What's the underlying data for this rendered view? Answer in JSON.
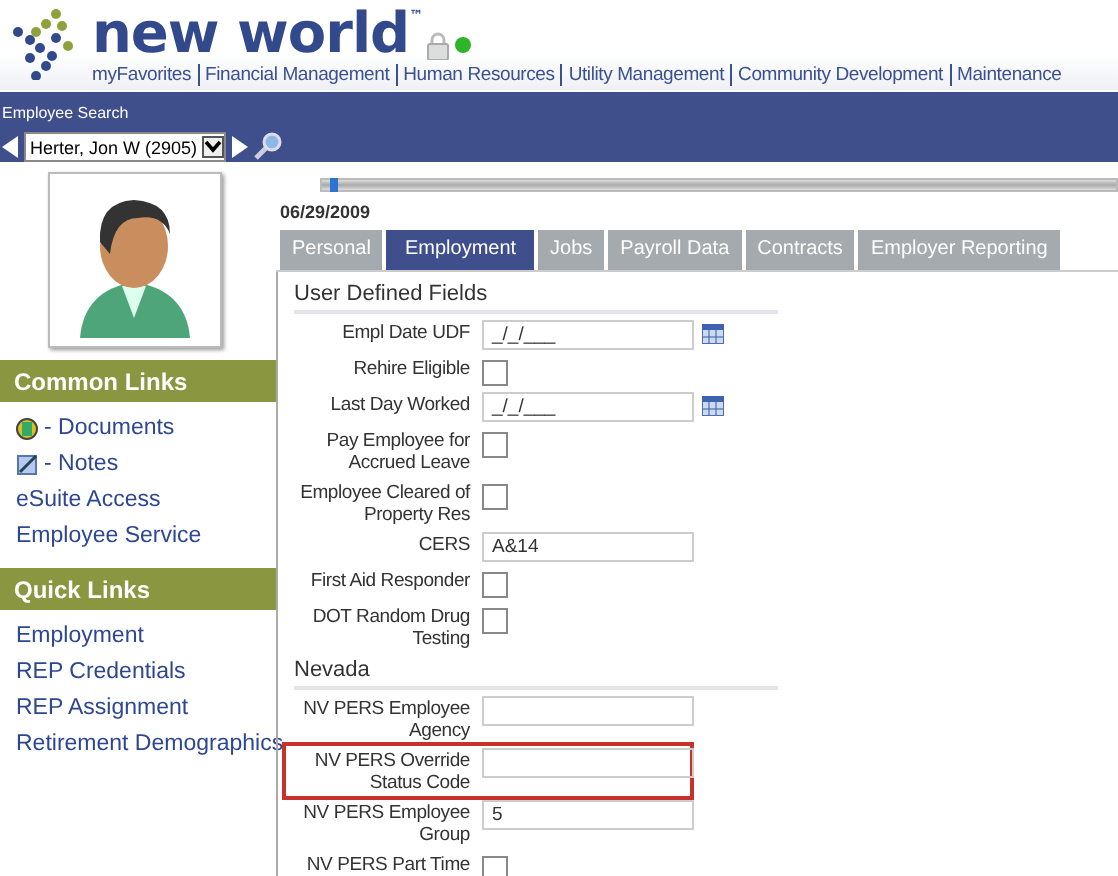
{
  "header": {
    "logo": "new world$^{™}$",
    "nav": [
      "myFavorites",
      "Financial Management",
      "Human Resources",
      "Utility Management",
      "Community Development",
      "Maintenance"
    ]
  },
  "search": {
    "title": "Employee Search",
    "value": "Herter, Jon W (2905)"
  },
  "sidebar": {
    "sections": [
      {
        "title": "Common Links",
        "items": [
          {
            "label": "- Documents",
            "kind": "document"
          },
          {
            "label": "- Notes",
            "kind": "note"
          },
          {
            "label": "eSuite Access"
          },
          {
            "label": "Employee Service"
          }
        ]
      },
      {
        "title": "Quick Links",
        "items": [
          {
            "label": "Employment"
          },
          {
            "label": "REP Credentials"
          },
          {
            "label": "REP Assignment"
          },
          {
            "label": "Retirement Demographics"
          }
        ]
      }
    ]
  },
  "timeline": {
    "level": 0.01
  },
  "date": "06/29/2009",
  "tabs": [
    {
      "label": "Personal",
      "selected": false
    },
    {
      "label": "Employment",
      "selected": true
    },
    {
      "label": "Jobs",
      "selected": false
    },
    {
      "label": "Payroll Data",
      "selected": false
    },
    {
      "label": "Contracts",
      "selected": false
    },
    {
      "label": "Employer Reporting",
      "selected": false
    }
  ],
  "sections": [
    {
      "title": "User Defined Fields",
      "fields": [
        {
          "label": "Empl Date UDF",
          "kind": "date",
          "value": "_/_/___",
          "highlighted": false
        },
        {
          "label": "Rehire Eligible",
          "kind": "checkbox",
          "checked": false,
          "highlighted": false
        },
        {
          "label": "Last Day Worked",
          "kind": "date",
          "value": "_/_/___",
          "highlighted": false
        },
        {
          "label": "Pay Employee for Accrued Leave",
          "kind": "checkbox",
          "checked": false,
          "highlighted": false
        },
        {
          "label": "Employee Cleared of Property Res",
          "kind": "checkbox",
          "checked": false,
          "highlighted": false
        },
        {
          "label": "CERS",
          "kind": "text",
          "value": "A&14",
          "highlighted": false
        },
        {
          "label": "First Aid Responder",
          "kind": "checkbox",
          "checked": false,
          "highlighted": false
        },
        {
          "label": "DOT Random Drug Testing",
          "kind": "checkbox",
          "checked": false,
          "highlighted": false
        }
      ]
    },
    {
      "title": "Nevada",
      "fields": [
        {
          "label": "NV PERS Employee Agency",
          "kind": "text",
          "highlighted": false
        },
        {
          "label": "NV PERS Override Status Code",
          "kind": "text",
          "highlighted": true
        },
        {
          "label": "NV PERS Employee Group",
          "kind": "text",
          "value": "5",
          "highlighted": false
        },
        {
          "label": "NV PERS Part Time",
          "kind": "checkbox",
          "checked": false,
          "highlighted": false
        }
      ]
    }
  ]
}
